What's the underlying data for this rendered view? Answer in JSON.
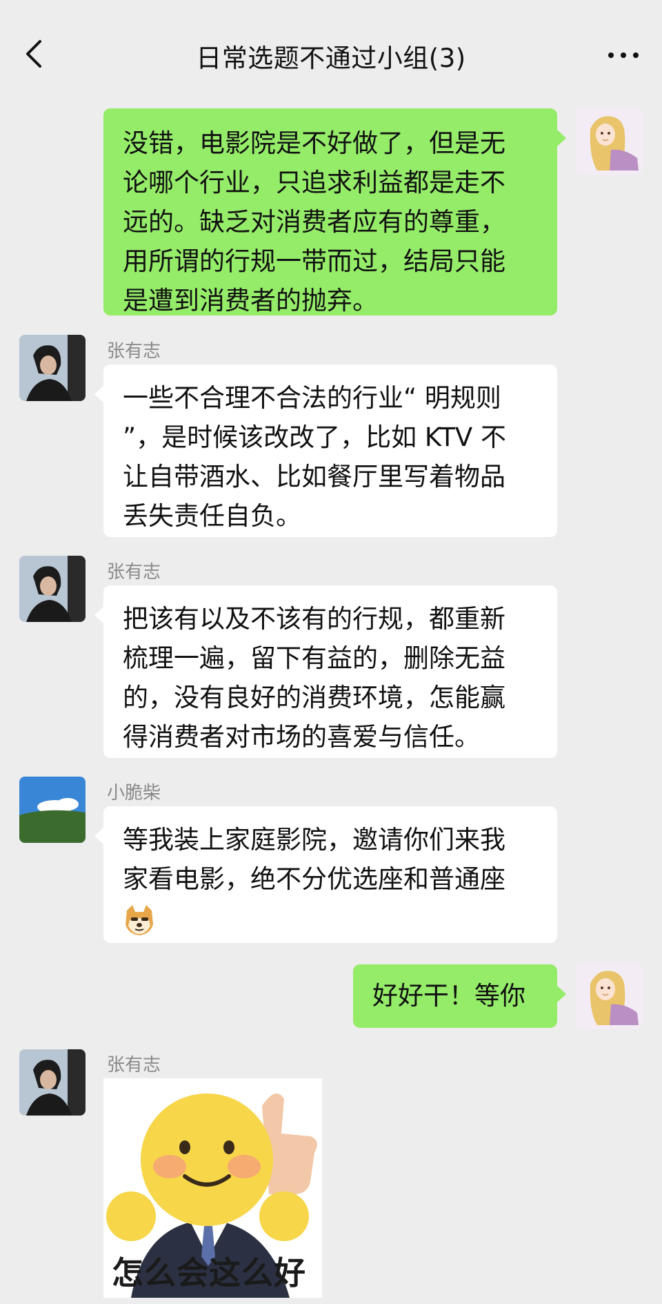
{
  "header": {
    "title": "日常选题不通过小组(3)",
    "back_icon": "chevron-left-icon",
    "more_icon": "more-dots-icon"
  },
  "messages": [
    {
      "side": "right",
      "lines": [
        "没错，电影院是不好做了，但是无",
        "论哪个行业，只追求利益都是走不",
        "远的。缺乏对消费者应有的尊重，",
        "用所谓的行规一带而过，结局只能",
        "是遭到消费者的抛弃。"
      ]
    },
    {
      "side": "left",
      "sender": "张有志",
      "lines": [
        "一些不合理不合法的行业“ 明规则",
        "”，是时候该改改了，比如 KTV 不",
        "让自带酒水、比如餐厅里写着物品",
        "丢失责任自负。"
      ]
    },
    {
      "side": "left",
      "sender": "张有志",
      "lines": [
        "把该有以及不该有的行规，都重新",
        "梳理一遍，留下有益的，删除无益",
        "的，没有良好的消费环境，怎能赢",
        "得消费者对市场的喜爱与信任。"
      ]
    },
    {
      "side": "left",
      "sender": "小脆柴",
      "lines": [
        "等我装上家庭影院，邀请你们来我",
        "家看电影，绝不分优选座和普通座"
      ],
      "emoji": "doge-emoji"
    },
    {
      "side": "right",
      "lines": [
        "好好干！等你"
      ]
    },
    {
      "side": "left",
      "sender": "张有志",
      "sticker_caption": "怎么会这么好",
      "sticker_icon": "thumbs-up-smiley-sticker"
    }
  ],
  "colors": {
    "background": "#ededed",
    "self_bubble": "#95ec69",
    "other_bubble": "#ffffff"
  }
}
